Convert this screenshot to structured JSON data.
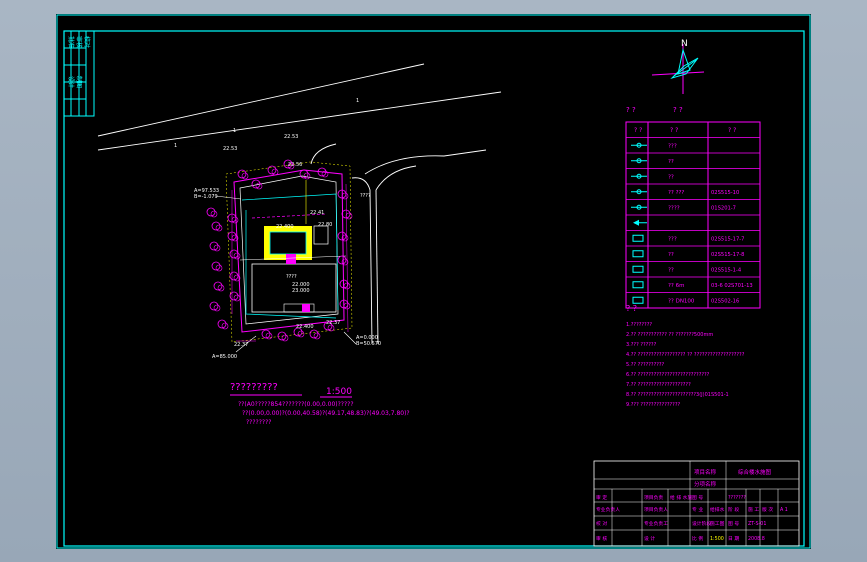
{
  "stamp_labels": [
    "批准",
    "审核",
    "校对",
    "设计",
    "制图"
  ],
  "north": {
    "label": "N"
  },
  "legend": {
    "title": "? ?",
    "headers": [
      "? ?",
      "? ?",
      "? ?"
    ],
    "rows": [
      {
        "name": "???",
        "code": ""
      },
      {
        "name": "??",
        "code": ""
      },
      {
        "name": "??",
        "code": ""
      },
      {
        "name": "?? ???",
        "code": "02S515-10"
      },
      {
        "name": "????",
        "code": "01S201-7"
      },
      {
        "name": "",
        "code": ""
      },
      {
        "name": "???",
        "code": "02S515-17-7"
      },
      {
        "name": "??",
        "code": "02S515-17-8"
      },
      {
        "name": "??",
        "code": "02S515-1-4"
      },
      {
        "name": "??    6m",
        "code": "03-6  02S701-13"
      },
      {
        "name": "??  DN100",
        "code": "02S502-16"
      }
    ]
  },
  "notes": {
    "title": "? ?",
    "lines": [
      "1.????????",
      "2.?? ??????????? ?? ???????500mm",
      "3.??? ??????",
      "4.?? ?????????????????? ?? ???????????????????",
      "5.?? ??????????",
      "6.?? ???????????????????????????",
      "7.?? ????????????????????",
      "8.?? ??????????????????????3(J)01S501-1",
      "9.??? ???????????????"
    ]
  },
  "site": {
    "title": "?????????",
    "scale": "1:500",
    "desc": [
      "??(A0?????854???????(0.00,0.00)?????",
      "??(0.00,0.00)?(0.00,40.58)?(49.17,48.83)?(49.03,7.80)?",
      "????????"
    ],
    "labels": [
      {
        "t": "1",
        "k": "road1a"
      },
      {
        "t": "1",
        "k": "road1b"
      },
      {
        "t": "1",
        "k": "road1c"
      },
      {
        "t": "22.53",
        "k": "e1"
      },
      {
        "t": "22.53",
        "k": "e2"
      },
      {
        "t": "22.56",
        "k": "e3"
      },
      {
        "t": "????",
        "k": "road2"
      },
      {
        "t": "A=97.533",
        "k": "c1"
      },
      {
        "t": "B=-1.079",
        "k": "c1b"
      },
      {
        "t": "A=85.000",
        "k": "c2"
      },
      {
        "t": "A=0.000",
        "k": "c3"
      },
      {
        "t": "B=50.570",
        "k": "c3b"
      },
      {
        "t": "22.400",
        "k": "b1"
      },
      {
        "t": "22.400",
        "k": "b2"
      },
      {
        "t": "22.41",
        "k": "b3"
      },
      {
        "t": "22.80",
        "k": "b4"
      },
      {
        "t": "22.000",
        "k": "b5"
      },
      {
        "t": "23.000",
        "k": "b6"
      },
      {
        "t": "????",
        "k": "b7"
      },
      {
        "t": "22.37",
        "k": "b8"
      },
      {
        "t": "22.37",
        "k": "b9"
      }
    ]
  },
  "title_block": {
    "project_name_label": "项目名称",
    "project_name": "综合楼水施图",
    "sub_label": "分项名称",
    "row1": [
      "审 定",
      "",
      "项目负责",
      "给 排 水施",
      "图 号",
      "",
      "???????"
    ],
    "row2": [
      "专业负责人",
      "",
      "项目负责人",
      "",
      "专 业",
      "给排水",
      "阶 段",
      "施 工",
      "版 次",
      "A 1"
    ],
    "row3": [
      "校 对",
      "",
      "专业负责工",
      "",
      "设计阶段",
      "施工图",
      "图 号",
      "ZT-S-01"
    ],
    "row4": [
      "审 核",
      "",
      "设 计",
      "",
      "比 例",
      "1:500",
      "日 期",
      "2008.8"
    ]
  }
}
